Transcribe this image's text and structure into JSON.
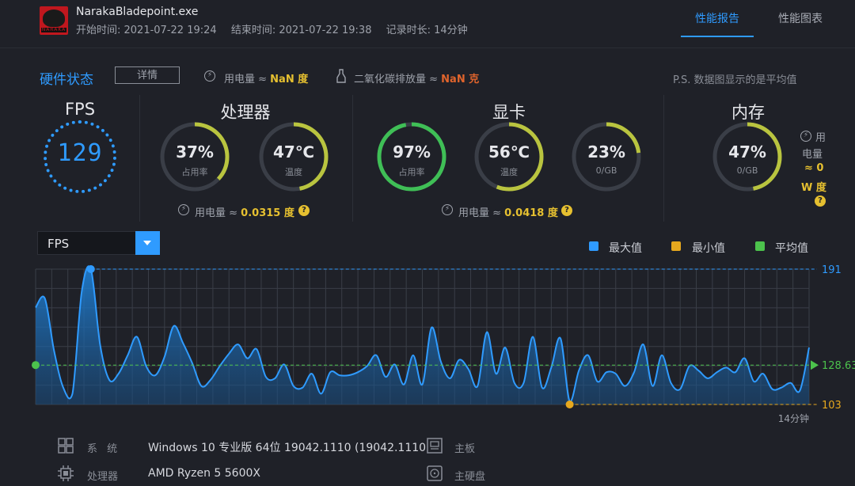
{
  "header": {
    "app_name": "NarakaBladepoint.exe",
    "icon_text": "NARAKA",
    "start_time": "开始时间: 2021-07-22 19:24",
    "end_time": "结束时间: 2021-07-22 19:38",
    "duration": "记录时长: 14分钟",
    "tabs": [
      {
        "label": "性能报告",
        "active": true
      },
      {
        "label": "性能图表",
        "active": false
      }
    ]
  },
  "hardware": {
    "title": "硬件状态",
    "detail_button": "详情",
    "power_text": "用电量 ≈",
    "power_value": "NaN 度",
    "co2_text": "二氧化碳排放量 ≈",
    "co2_value": "NaN 克",
    "ps_note": "P.S. 数据图显示的是平均值",
    "fps": {
      "title": "FPS",
      "value": "129"
    },
    "cpu": {
      "title": "处理器",
      "usage": {
        "value": "37%",
        "label": "占用率",
        "percent": 37
      },
      "temp": {
        "value": "47℃",
        "label": "温度",
        "percent": 47
      },
      "power_text": "用电量 ≈",
      "power_value": "0.0315 度",
      "help": "?"
    },
    "gpu": {
      "title": "显卡",
      "usage": {
        "value": "97%",
        "label": "占用率",
        "percent": 97
      },
      "temp": {
        "value": "56℃",
        "label": "温度",
        "percent": 56
      },
      "mem": {
        "value": "23%",
        "label": "0/GB",
        "percent": 23
      },
      "power_text": "用电量 ≈",
      "power_value": "0.0418 度",
      "help": "?"
    },
    "memory": {
      "title": "内存",
      "usage": {
        "value": "47%",
        "label": "0/GB",
        "percent": 47
      },
      "power_line1": "用",
      "power_line2": "电量",
      "power_line3": "≈ 0",
      "power_line4": "W 度",
      "help": "?"
    }
  },
  "chart_controls": {
    "selected_metric": "FPS",
    "legend": [
      {
        "label": "最大值",
        "color": "#2f9bff"
      },
      {
        "label": "最小值",
        "color": "#e6a81e"
      },
      {
        "label": "平均值",
        "color": "#4cc24c"
      }
    ]
  },
  "chart_data": {
    "type": "area",
    "title": "",
    "xlabel": "",
    "ylabel": "",
    "x_end_label": "14分钟",
    "ylim": [
      103,
      191
    ],
    "max_label": "191",
    "avg_label": "128.63",
    "min_label": "103",
    "max_value": 191,
    "avg_value": 128.63,
    "min_value": 103,
    "colors": {
      "line": "#2f9bff",
      "max": "#2f9bff",
      "min": "#e6a81e",
      "avg": "#4cc24c"
    },
    "values": [
      166,
      172,
      138,
      114,
      110,
      176,
      191,
      142,
      119,
      123,
      135,
      147,
      128,
      122,
      134,
      154,
      143,
      130,
      115,
      119,
      128,
      136,
      142,
      133,
      139,
      121,
      120,
      129,
      115,
      114,
      123,
      110,
      124,
      122,
      122,
      124,
      128,
      135,
      121,
      129,
      116,
      135,
      116,
      153,
      131,
      120,
      132,
      126,
      115,
      150,
      123,
      140,
      117,
      117,
      147,
      114,
      127,
      146,
      105,
      125,
      135,
      118,
      124,
      123,
      115,
      124,
      142,
      115,
      135,
      117,
      113,
      128,
      125,
      120,
      124,
      127,
      124,
      133,
      118,
      123,
      113,
      114,
      117,
      112,
      140
    ],
    "max_index": 6,
    "min_index": 58
  },
  "system_info": {
    "items": [
      {
        "label": "系 统",
        "value": "Windows 10 专业版 64位   19042.1110 (19042.1110"
      },
      {
        "label": "处理器",
        "value": "AMD Ryzen 5 5600X"
      },
      {
        "label": "主板",
        "value": ""
      },
      {
        "label": "主硬盘",
        "value": ""
      }
    ]
  }
}
